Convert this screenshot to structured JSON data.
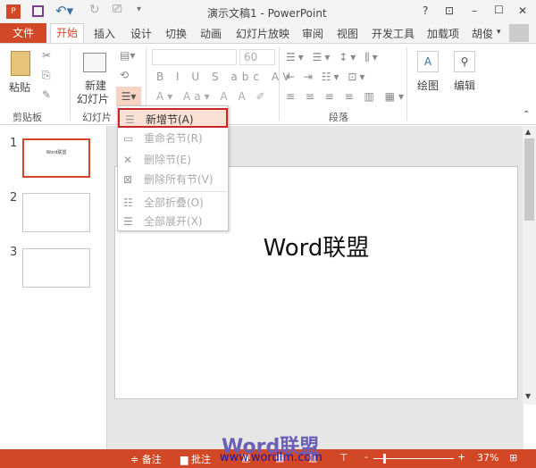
{
  "title": "演示文稿1 - PowerPoint",
  "window_controls": {
    "help": "?",
    "restore": "⊡",
    "minimize": "–",
    "maximize": "☐",
    "close": "✕"
  },
  "tabs": [
    "文件",
    "开始",
    "插入",
    "设计",
    "切换",
    "动画",
    "幻灯片放映",
    "审阅",
    "视图",
    "开发工具",
    "加载项"
  ],
  "user": "胡俊",
  "ribbon": {
    "paste": "粘贴",
    "new_slide_1": "新建",
    "new_slide_2": "幻灯片",
    "font_size": "60",
    "draw": "绘图",
    "edit": "编辑",
    "groups": {
      "clipboard": "剪贴板",
      "slides": "幻灯片",
      "paragraph": "段落"
    }
  },
  "menu": [
    {
      "label": "新增节(A)",
      "enabled": true
    },
    {
      "label": "重命名节(R)",
      "enabled": false
    },
    {
      "label": "删除节(E)",
      "enabled": false
    },
    {
      "label": "删除所有节(V)",
      "enabled": false
    },
    {
      "label": "全部折叠(O)",
      "enabled": false
    },
    {
      "label": "全部展开(X)",
      "enabled": false
    }
  ],
  "slides": [
    {
      "num": "1",
      "text": "Word联盟"
    },
    {
      "num": "2"
    },
    {
      "num": "3"
    }
  ],
  "slide_text": "Word联盟",
  "status": {
    "notes": "备注",
    "comments": "批注",
    "zoom": "37%"
  },
  "watermark": {
    "logo": "Word联盟",
    "url": "www.wordlm.com"
  },
  "colors": {
    "accent": "#d24726"
  }
}
